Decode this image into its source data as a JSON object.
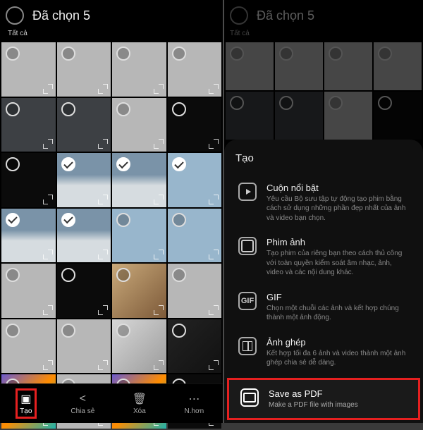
{
  "left": {
    "header_title": "Đã chọn 5",
    "header_all": "Tất cả",
    "bottom": {
      "create": "Tạo",
      "share": "Chia sẻ",
      "delete": "Xóa",
      "more": "N.hơn"
    }
  },
  "right": {
    "header_title": "Đã chọn 5",
    "header_all": "Tất cả",
    "sheet_title": "Tạo",
    "options": [
      {
        "title": "Cuộn nổi bật",
        "desc": "Yêu cầu Bộ sưu tập tự động tạo phim bằng cách sử dụng những phần đẹp nhất của ảnh và video bạn chọn."
      },
      {
        "title": "Phim ảnh",
        "desc": "Tạo phim của riêng bạn theo cách thủ công với toàn quyền kiểm soát âm nhạc, ảnh, video và các nội dung khác."
      },
      {
        "title": "GIF",
        "desc": "Chọn một chuỗi các ảnh và kết hợp chúng thành một ảnh động."
      },
      {
        "title": "Ảnh ghép",
        "desc": "Kết hợp tối đa 6 ảnh và video thành một ảnh ghép chia sẻ dễ dàng."
      },
      {
        "title": "Save as PDF",
        "desc": "Make a PDF file with images"
      }
    ]
  }
}
